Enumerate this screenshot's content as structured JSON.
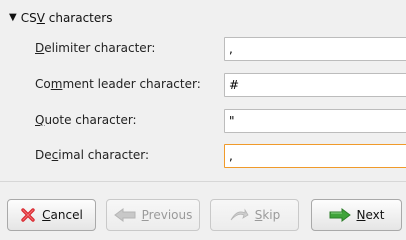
{
  "section": {
    "title_prefix": "CS",
    "title_mnemonic": "V",
    "title_suffix": " characters",
    "toggle_glyph": "▼"
  },
  "fields": [
    {
      "label_pre": "",
      "label_mn": "D",
      "label_post": "elimiter character:",
      "value": ","
    },
    {
      "label_pre": "Co",
      "label_mn": "m",
      "label_post": "ment leader character:",
      "value": "#"
    },
    {
      "label_pre": "",
      "label_mn": "Q",
      "label_post": "uote character:",
      "value": "\""
    },
    {
      "label_pre": "De",
      "label_mn": "c",
      "label_post": "imal character:",
      "value": ","
    }
  ],
  "buttons": {
    "cancel": {
      "mn": "C",
      "rest": "ancel",
      "icon": "red-x-icon"
    },
    "previous": {
      "mn": "P",
      "rest": "revious",
      "icon": "arrow-left-icon"
    },
    "skip": {
      "mn": "S",
      "rest": "kip",
      "icon": "skip-icon"
    },
    "next": {
      "mn": "N",
      "rest": "ext",
      "icon": "arrow-right-icon"
    }
  },
  "colors": {
    "focus_border": "#f09a2a",
    "next_arrow": "#3fa33a",
    "cancel_x": "#d8262d"
  }
}
